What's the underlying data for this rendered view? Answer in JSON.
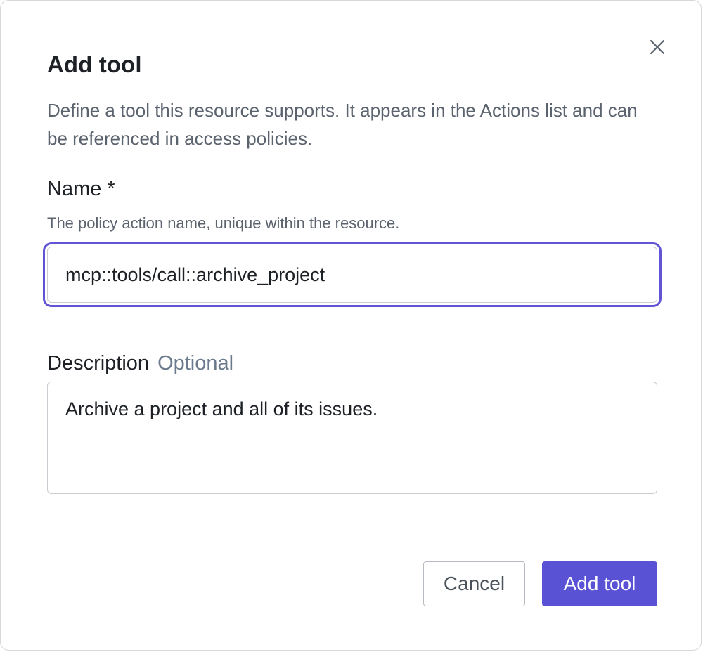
{
  "dialog": {
    "title": "Add tool",
    "subtitle": "Define a tool this resource supports. It appears in the Actions list and can be referenced in access policies.",
    "close_icon": "close-icon"
  },
  "name_field": {
    "label": "Name *",
    "hint": "The policy action name, unique within the resource.",
    "value": "mcp::tools/call::archive_project",
    "focus_color": "#6155d6"
  },
  "description_field": {
    "label": "Description",
    "optional_label": "Optional",
    "value": "Archive a project and all of its issues."
  },
  "footer": {
    "cancel_label": "Cancel",
    "submit_label": "Add tool",
    "submit_color": "#5a52d5"
  }
}
